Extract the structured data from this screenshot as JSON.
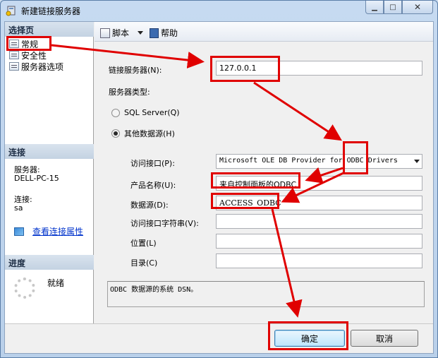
{
  "window": {
    "title": "新建链接服务器"
  },
  "sidebar": {
    "select_page_header": "选择页",
    "pages": [
      {
        "label": "常规"
      },
      {
        "label": "安全性"
      },
      {
        "label": "服务器选项"
      }
    ],
    "connection_header": "连接",
    "server_label": "服务器:",
    "server_value": "DELL-PC-15",
    "connection_label": "连接:",
    "connection_value": "sa",
    "view_properties_link": "查看连接属性",
    "progress_header": "进度",
    "progress_status": "就绪"
  },
  "toolbar": {
    "script_label": "脚本",
    "help_label": "帮助"
  },
  "form": {
    "linked_server_label": "链接服务器(N):",
    "linked_server_value": "127.0.0.1",
    "server_type_label": "服务器类型:",
    "radio_sql_server": "SQL Server(Q)",
    "radio_other": "其他数据源(H)",
    "provider_label": "访问接口(P):",
    "provider_value": "Microsoft OLE DB Provider for ODBC Drivers",
    "product_name_label": "产品名称(U):",
    "product_name_value": "来自控制面板的ODBC",
    "data_source_label": "数据源(D):",
    "data_source_value": "ACCESS_ODBC",
    "provider_string_label": "访问接口字符串(V):",
    "provider_string_value": "",
    "location_label": "位置(L)",
    "location_value": "",
    "catalog_label": "目录(C)",
    "catalog_value": "",
    "description": "ODBC 数据源的系统 DSN。"
  },
  "buttons": {
    "ok": "确定",
    "cancel": "取消"
  },
  "colors": {
    "annotation_red": "#e00000",
    "link_blue": "#0033cc"
  }
}
